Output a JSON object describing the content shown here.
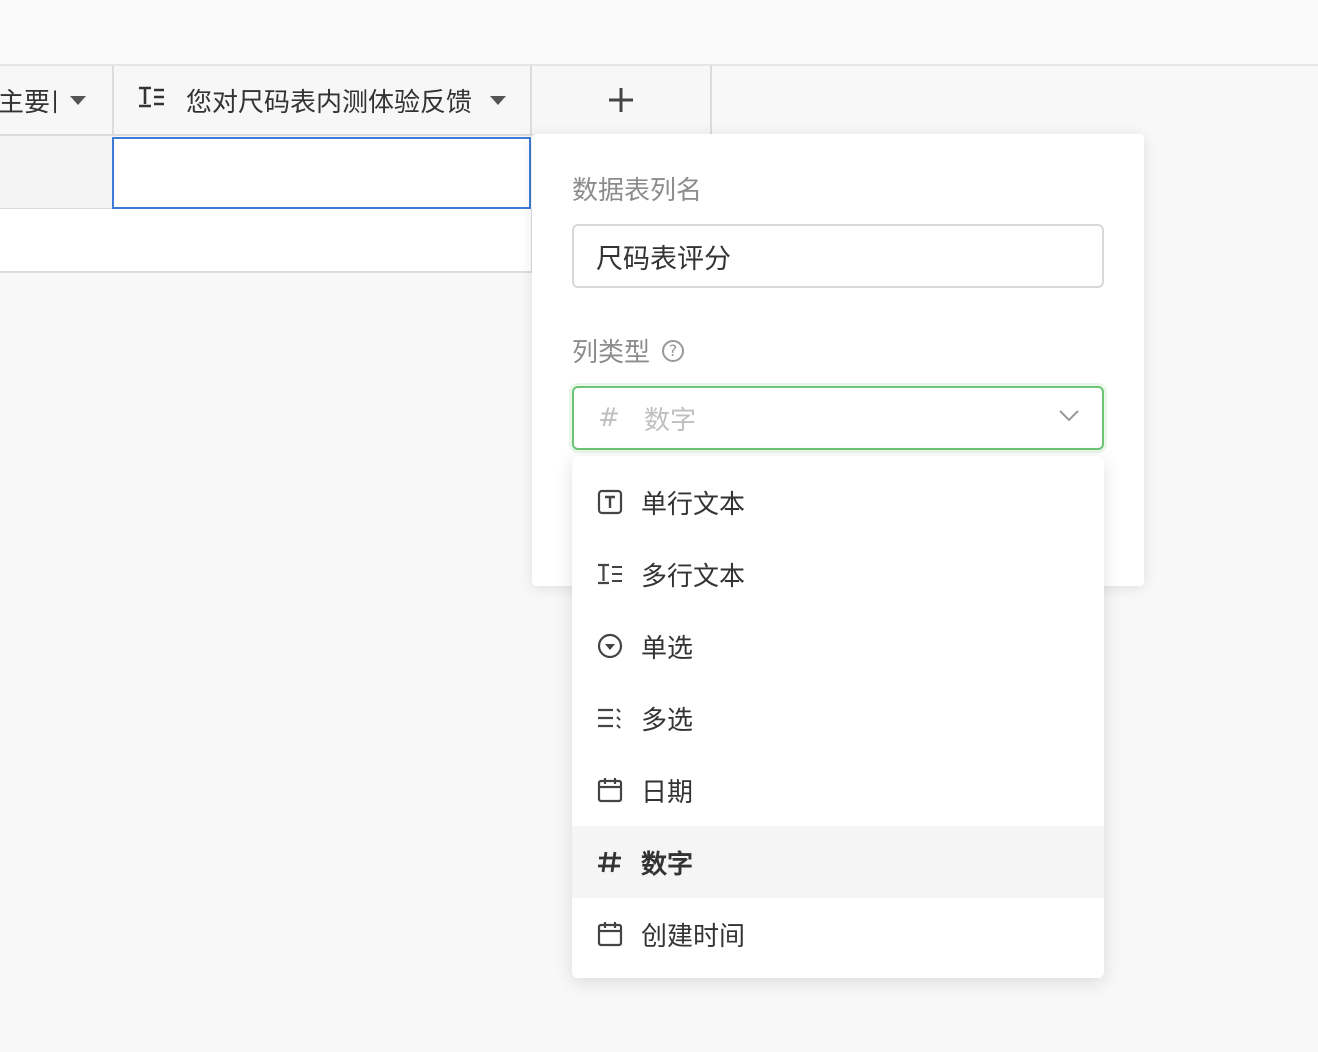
{
  "table": {
    "columns": [
      {
        "label": "主要目",
        "icon": "text-icon"
      },
      {
        "label": "您对尺码表内测体验反馈",
        "icon": "multiline-text-icon"
      }
    ],
    "add_column": "+"
  },
  "panel": {
    "name_label": "数据表列名",
    "name_value": "尺码表评分",
    "type_label": "列类型",
    "help_icon": "?",
    "selected_type": "数字",
    "selected_icon": "#"
  },
  "dropdown": {
    "options": [
      {
        "label": "单行文本",
        "icon": "single-line-text-icon"
      },
      {
        "label": "多行文本",
        "icon": "multi-line-text-icon"
      },
      {
        "label": "单选",
        "icon": "single-select-icon"
      },
      {
        "label": "多选",
        "icon": "multi-select-icon"
      },
      {
        "label": "日期",
        "icon": "calendar-icon"
      },
      {
        "label": "数字",
        "icon": "hash-icon",
        "selected": true
      },
      {
        "label": "创建时间",
        "icon": "calendar-icon"
      }
    ]
  },
  "colors": {
    "accent_border": "#6cc474",
    "cell_focus": "#3e7bd6",
    "selected_bg": "#f5f5f5"
  }
}
